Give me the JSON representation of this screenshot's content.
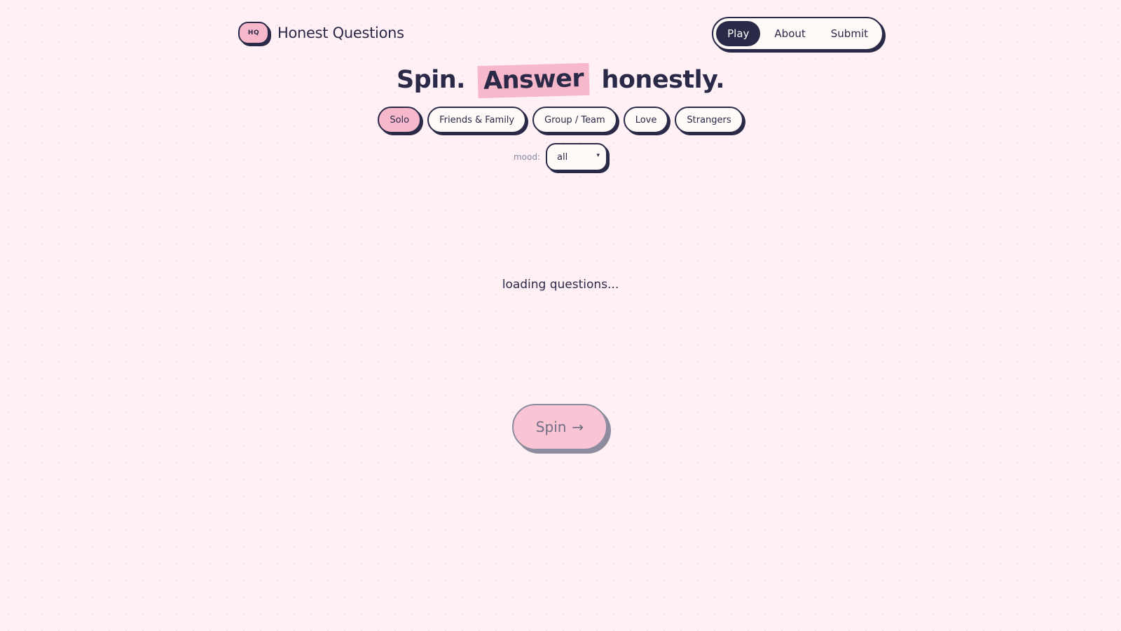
{
  "app": {
    "logo_badge": "HQ",
    "title": "Honest Questions"
  },
  "nav": {
    "items": [
      {
        "label": "Play",
        "active": true
      },
      {
        "label": "About",
        "active": false
      },
      {
        "label": "Submit",
        "active": false
      }
    ]
  },
  "hero": {
    "part1": "Spin.",
    "highlight": "Answer",
    "part2": "honestly."
  },
  "categories": {
    "items": [
      {
        "label": "Solo",
        "active": true
      },
      {
        "label": "Friends & Family",
        "active": false
      },
      {
        "label": "Group / Team",
        "active": false
      },
      {
        "label": "Love",
        "active": false
      },
      {
        "label": "Strangers",
        "active": false
      }
    ]
  },
  "mood": {
    "label": "mood:",
    "selected": "all",
    "caret": "▾"
  },
  "status": {
    "loading_text": "loading questions..."
  },
  "spin_button": {
    "label": "Spin",
    "arrow": "→"
  },
  "colors": {
    "background": "#fff0f5",
    "ink": "#2a2a48",
    "accent_pink": "#f7b8cb",
    "card": "#fffaf7",
    "muted": "#8a8aa0"
  }
}
